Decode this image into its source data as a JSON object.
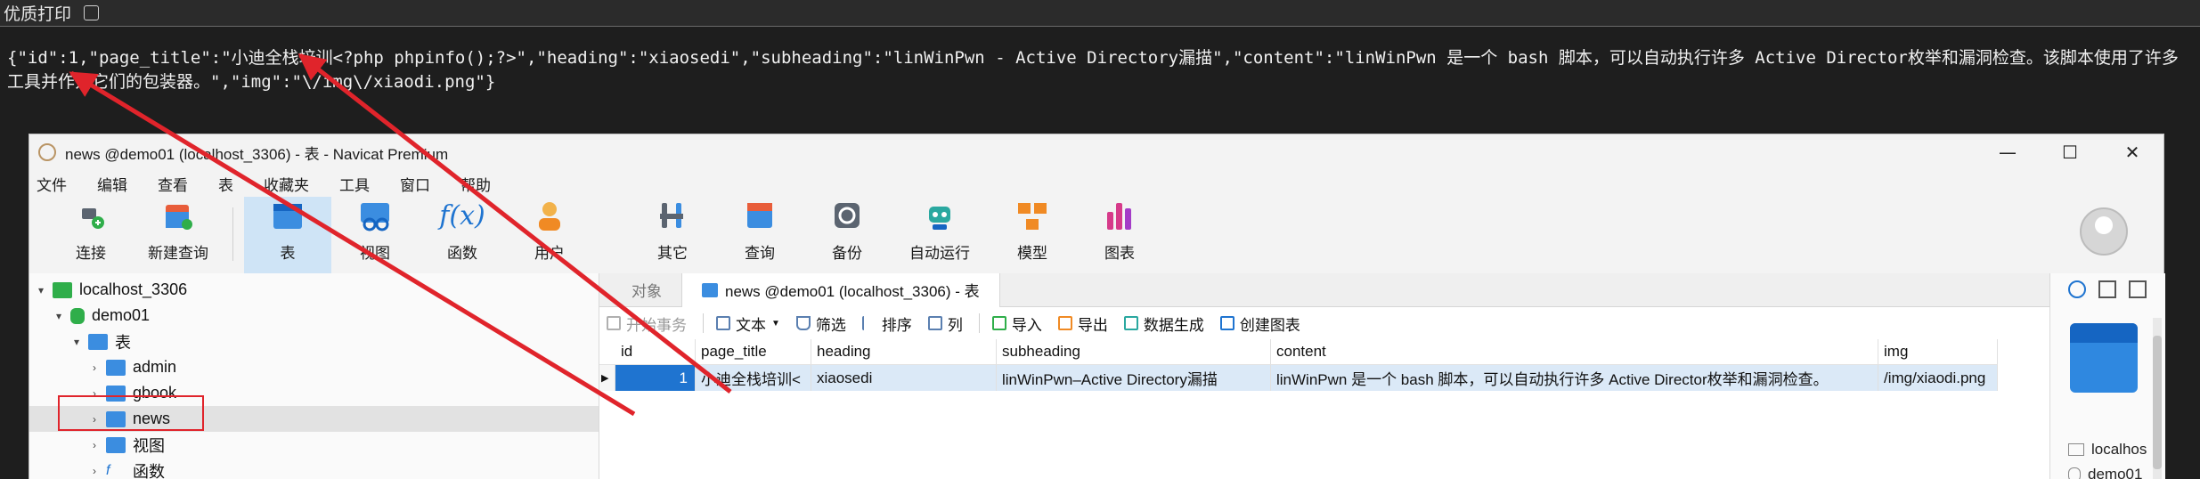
{
  "browser": {
    "print_label": "优质打印"
  },
  "output_text": "{\"id\":1,\"page_title\":\"小迪全栈培训<?php phpinfo();?>\",\"heading\":\"xiaosedi\",\"subheading\":\"linWinPwn - Active Directory漏描\",\"content\":\"linWinPwn 是一个 bash 脚本，可以自动执行许多 Active Director枚举和漏洞检查。该脚本使用了许多工具并作为它们的包装器。\",\"img\":\"\\/img\\/xiaodi.png\"}",
  "window": {
    "title": "news @demo01 (localhost_3306) - 表 - Navicat Premium",
    "minimize": "—",
    "maximize": "☐",
    "close": "✕"
  },
  "menu": [
    "文件",
    "编辑",
    "查看",
    "表",
    "收藏夹",
    "工具",
    "窗口",
    "帮助"
  ],
  "toolbar": {
    "connect": "连接",
    "new_query": "新建查询",
    "table": "表",
    "view": "视图",
    "function": "函数",
    "user": "用户",
    "other": "其它",
    "query": "查询",
    "backup": "备份",
    "auto_run": "自动运行",
    "model": "模型",
    "chart": "图表"
  },
  "tree": {
    "connection": "localhost_3306",
    "database": "demo01",
    "tables_group": "表",
    "tables": [
      "admin",
      "gbook",
      "news"
    ],
    "views_group": "视图",
    "functions_group": "函数"
  },
  "tabs": {
    "objects": "对象",
    "active": "news @demo01 (localhost_3306) - 表"
  },
  "table_toolbar": {
    "begin_tx": "开始事务",
    "text": "文本",
    "filter": "筛选",
    "sort": "排序",
    "columns": "列",
    "import": "导入",
    "export": "导出",
    "generate": "数据生成",
    "create_chart": "创建图表"
  },
  "grid": {
    "columns": [
      "id",
      "page_title",
      "heading",
      "subheading",
      "content",
      "img"
    ],
    "row": [
      "1",
      "小迪全栈培训<",
      "xiaosedi",
      "linWinPwn–Active Directory漏描",
      "linWinPwn 是一个 bash 脚本，可以自动执行许多 Active Director枚举和漏洞检查。",
      "/img/xiaodi.png"
    ]
  },
  "info_pane": {
    "line1": "localhos",
    "line2": "demo01"
  },
  "colors": {
    "highlight_red": "#e0242b",
    "selection_blue": "#1f74d0"
  }
}
